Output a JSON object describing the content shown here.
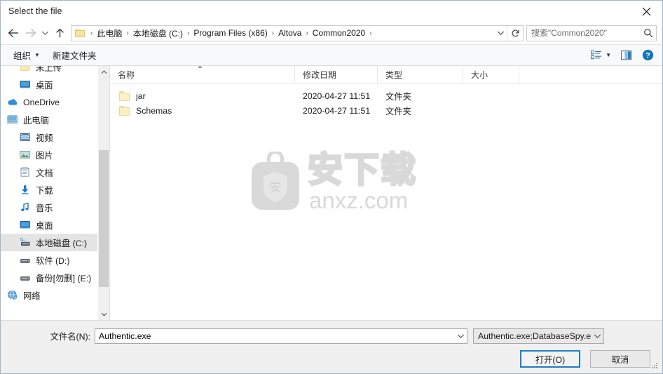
{
  "window": {
    "title": "Select the file",
    "close_icon": "close-icon"
  },
  "address_bar": {
    "back_icon": "back-arrow-icon",
    "forward_icon": "forward-arrow-icon",
    "recent_icon": "chevron-down-icon",
    "up_icon": "up-arrow-icon",
    "folder_icon": "folder-icon",
    "breadcrumbs": [
      "此电脑",
      "本地磁盘 (C:)",
      "Program Files (x86)",
      "Altova",
      "Common2020"
    ],
    "separator": "›",
    "dropdown_icon": "chevron-down-icon",
    "refresh_icon": "refresh-icon"
  },
  "search": {
    "placeholder": "搜索\"Common2020\"",
    "value": "",
    "icon": "search-icon"
  },
  "toolbar": {
    "organize_label": "组织",
    "organize_caret": "▼",
    "new_folder_label": "新建文件夹",
    "view_icon": "view-options-icon",
    "view_caret": "▼",
    "preview_pane_icon": "preview-pane-icon",
    "help_icon": "help-icon",
    "help_glyph": "?"
  },
  "sidebar": {
    "items": [
      {
        "label": "未上传",
        "icon": "folder-icon",
        "indent": 1,
        "selected": false
      },
      {
        "label": "桌面",
        "icon": "desktop-icon",
        "indent": 1,
        "selected": false
      },
      {
        "label": "OneDrive",
        "icon": "onedrive-icon",
        "indent": 0,
        "selected": false
      },
      {
        "label": "此电脑",
        "icon": "this-pc-icon",
        "indent": 0,
        "selected": false
      },
      {
        "label": "视频",
        "icon": "videos-icon",
        "indent": 1,
        "selected": false
      },
      {
        "label": "图片",
        "icon": "pictures-icon",
        "indent": 1,
        "selected": false
      },
      {
        "label": "文档",
        "icon": "documents-icon",
        "indent": 1,
        "selected": false
      },
      {
        "label": "下载",
        "icon": "downloads-icon",
        "indent": 1,
        "selected": false
      },
      {
        "label": "音乐",
        "icon": "music-icon",
        "indent": 1,
        "selected": false
      },
      {
        "label": "桌面",
        "icon": "desktop-icon",
        "indent": 1,
        "selected": false
      },
      {
        "label": "本地磁盘 (C:)",
        "icon": "local-disk-icon",
        "indent": 1,
        "selected": true
      },
      {
        "label": "软件 (D:)",
        "icon": "drive-icon",
        "indent": 1,
        "selected": false
      },
      {
        "label": "备份[勿删] (E:)",
        "icon": "drive-icon",
        "indent": 1,
        "selected": false
      },
      {
        "label": "网络",
        "icon": "network-icon",
        "indent": 0,
        "selected": false
      }
    ],
    "scroll_up_icon": "scroll-up-icon",
    "scroll_down_icon": "scroll-down-icon"
  },
  "file_list": {
    "columns": [
      {
        "key": "name",
        "label": "名称"
      },
      {
        "key": "date",
        "label": "修改日期"
      },
      {
        "key": "type",
        "label": "类型"
      },
      {
        "key": "size",
        "label": "大小"
      }
    ],
    "sort_indicator": "▲",
    "rows": [
      {
        "name": "jar",
        "date": "2020-04-27 11:51",
        "type": "文件夹",
        "size": "",
        "icon": "folder-icon"
      },
      {
        "name": "Schemas",
        "date": "2020-04-27 11:51",
        "type": "文件夹",
        "size": "",
        "icon": "folder-icon"
      }
    ]
  },
  "watermark": {
    "badge_glyph": "安",
    "cn_text": "安下载",
    "en_text": "anxz.com",
    "color": "#d9d9d9"
  },
  "bottom": {
    "filename_label": "文件名(N):",
    "filename_value": "Authentic.exe",
    "filename_placeholder": "",
    "filename_dropdown_icon": "chevron-down-icon",
    "filter_value": "Authentic.exe;DatabaseSpy.e",
    "filter_dropdown_icon": "chevron-down-icon",
    "open_button": "打开(O)",
    "cancel_button": "取消"
  },
  "colors": {
    "accent": "#1d7fc2",
    "selection": "#e4e4e4",
    "bottom_bg": "#f0f0f0",
    "toolbar_bg": "#f7f9fb"
  }
}
